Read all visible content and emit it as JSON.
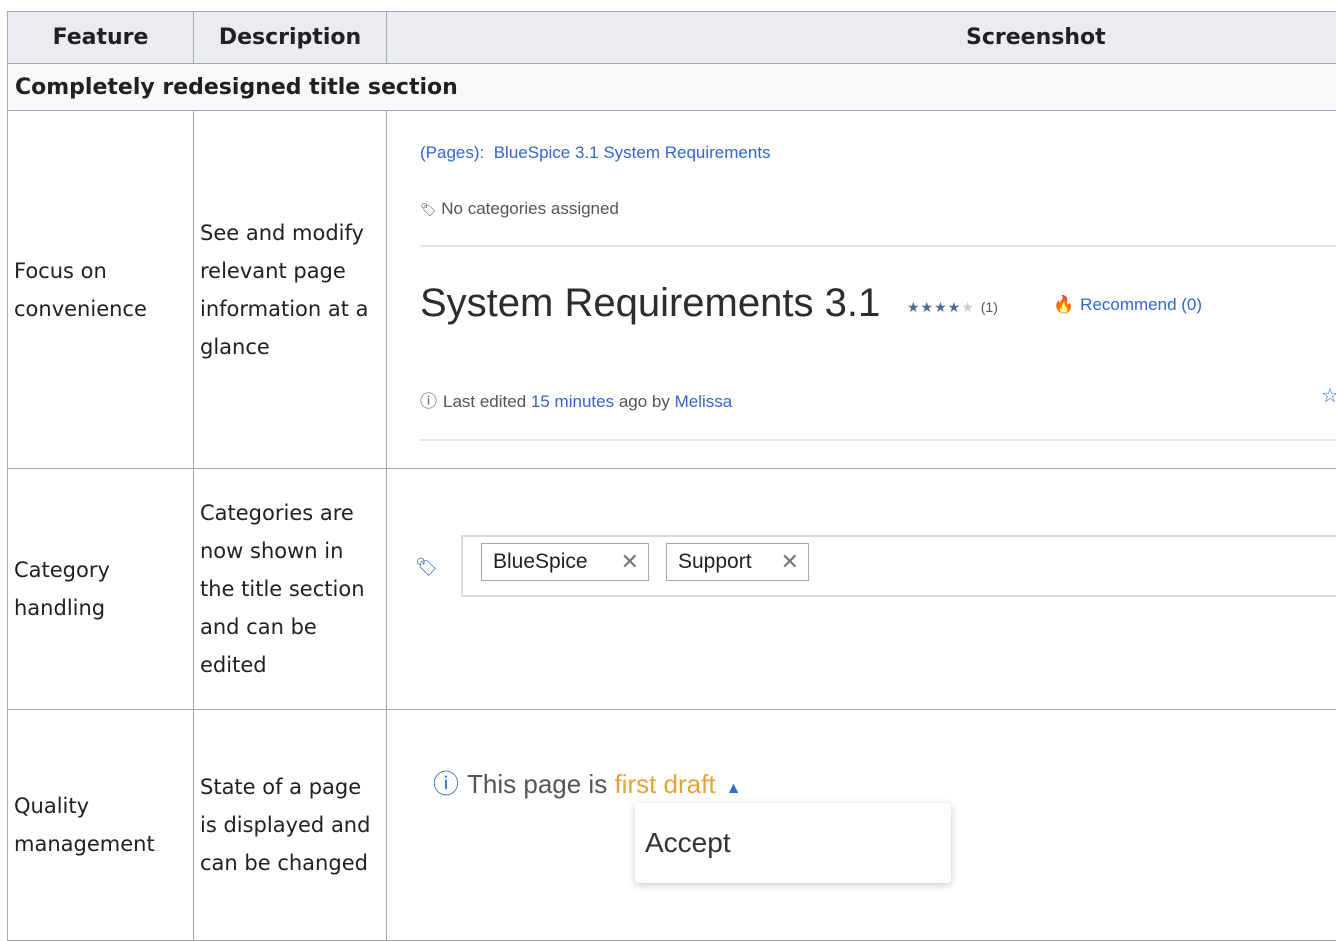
{
  "headers": {
    "feature": "Feature",
    "description": "Description",
    "screenshot": "Screenshot"
  },
  "section": "Completely redesigned title section",
  "rows": [
    {
      "feature": "Focus on convenience",
      "description": "See and modify relevant page information at a glance",
      "screenshot": {
        "breadcrumb_ns": "(Pages):",
        "breadcrumb_page": "BlueSpice 3.1 System Requirements",
        "categories_icon": "🏷",
        "no_categories": "No categories assigned",
        "title": "System Requirements 3.1",
        "stars_filled": "★★★★",
        "stars_empty": "★",
        "rating_value": 4,
        "rating_max": 5,
        "rating_count": "(1)",
        "recommend_icon": "🔥",
        "recommend": "Recommend (0)",
        "info_icon": "ⓘ",
        "last_edited_prefix": "Last edited",
        "last_edited_time": "15 minutes",
        "last_edited_mid": "ago by",
        "last_edited_user": "Melissa",
        "watch_icon": "☆"
      }
    },
    {
      "feature": "Category handling",
      "description": "Categories are now shown in the title section and can be edited",
      "screenshot": {
        "tag_icon": "🏷",
        "chips": [
          "BlueSpice",
          "Support"
        ],
        "remove_glyph": "✕"
      }
    },
    {
      "feature": "Quality management",
      "description": "State of a page is displayed and can be changed",
      "screenshot": {
        "info_icon": "ⓘ",
        "state_prefix": "This page is",
        "state_value": "first draft",
        "caret": "▲",
        "menu_item": "Accept"
      }
    }
  ],
  "colors": {
    "link": "#3366cc",
    "draft": "#e1a53a",
    "header_bg": "#eaecf0",
    "border": "#a2a9b1"
  }
}
